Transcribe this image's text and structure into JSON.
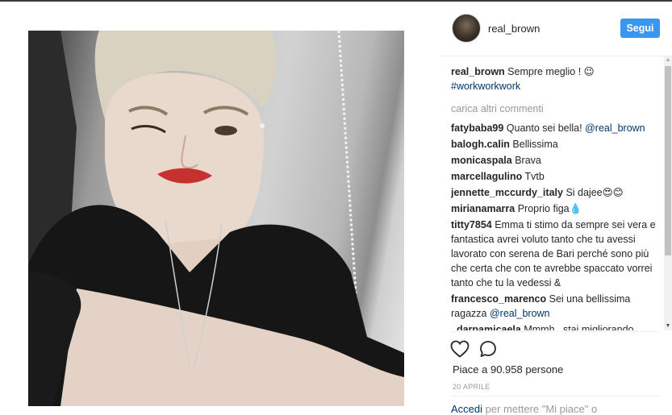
{
  "post": {
    "username": "real_brown",
    "follow_label": "Segui"
  },
  "caption": {
    "user": "real_brown",
    "text": "Sempre meglio ! 😉",
    "hashtag": "#workworkwork"
  },
  "load_more": "carica altri commenti",
  "comments": [
    {
      "user": "fatybaba99",
      "text": "Quanto sei bella!",
      "mention": "@real_brown"
    },
    {
      "user": "balogh.calin",
      "text": "Bellissima"
    },
    {
      "user": "monicaspala",
      "text": "Brava"
    },
    {
      "user": "marcellagulino",
      "text": "Tvtb"
    },
    {
      "user": "jennette_mccurdy_italy",
      "text": "Si dajee😍😊"
    },
    {
      "user": "mirianamarra",
      "text": "Proprio figa💧"
    },
    {
      "user": "titty7854",
      "text": "Emma ti stimo da sempre sei vera e fantastica avrei voluto tanto che tu avessi lavorato con serena de Bari perché sono più che certa che con te avrebbe spaccato vorrei tanto che tu la vedessi &"
    },
    {
      "user": "francesco_marenco",
      "text": "Sei una bellissima ragazza",
      "mention": "@real_brown"
    },
    {
      "user": "_darpamicaela",
      "text": "Mmmh...stai migliorando"
    }
  ],
  "likes_text": "Piace a 90.958 persone",
  "date": "20 APRILE",
  "login": {
    "link": "Accedi",
    "text": " per mettere \"Mi piace\" o"
  },
  "colors": {
    "follow_button": "#3897f0",
    "link": "#003569",
    "muted": "#999999"
  },
  "icons": [
    "heart-icon",
    "comment-icon",
    "avatar"
  ]
}
